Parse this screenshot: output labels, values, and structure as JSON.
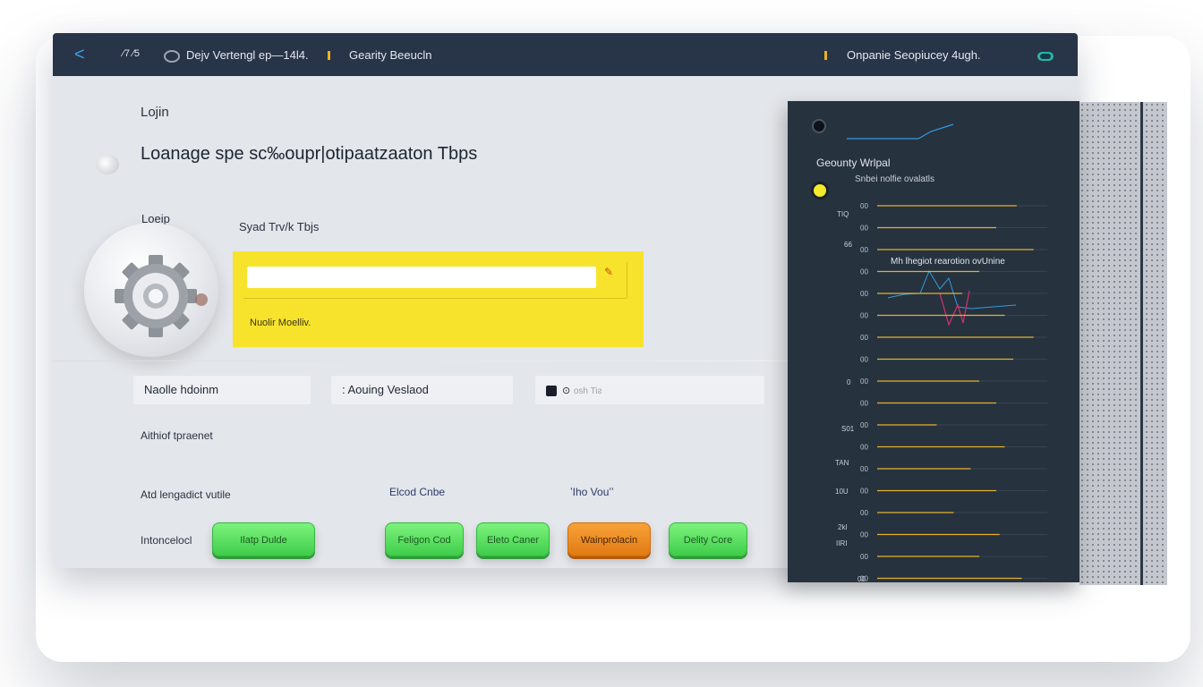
{
  "titlebar": {
    "back": "<",
    "item1": "⁄7 ⁄5",
    "item2": "Dejv Vertengl ep—14l4.",
    "item3": "Gearity Beeucln",
    "item4": "Onpanie Seopiucey 4ugh.",
    "accent_color": "#283448"
  },
  "main": {
    "label_top": "Lojin",
    "heading": "Loanage spe sc‰oupr|otipaatzaaton Tbps",
    "label_lojin": "Loeip",
    "label_syad": "Syad Trv/k Tbjs",
    "yellow_card": {
      "input_value": "",
      "note": "Nuolir Moelliv.",
      "edit": "✎",
      "color": "#f7e32c"
    },
    "fields": [
      {
        "value": "Naolle hdoinm"
      },
      {
        "value": ": Aouing Veslaod"
      },
      {
        "value": "",
        "placeholder": "osh   Tiƨ"
      }
    ],
    "field3_prefix": "⊙",
    "label_attrib": "Aithiof tpraenet",
    "label_atd": "Atd lengadict vutile",
    "label_elcod": "Elcod Cnbe",
    "label_ho": "ʼIho Vouʼʼ",
    "label_int": "Intoncelocl",
    "buttons": [
      {
        "label": "Ilatp Dulde",
        "color": "green"
      },
      {
        "label": "Feligon Cod",
        "color": "green"
      },
      {
        "label": "Eleto Caner",
        "color": "green"
      },
      {
        "label": "Wainprolacin",
        "color": "orange"
      },
      {
        "label": "Delity Core",
        "color": "green"
      }
    ]
  },
  "panel": {
    "title": "Geounty Wrlpal",
    "subtitle": "Snbei nolfie ovalatls",
    "annotation": "Mh lhegiot rearotion ovUnine",
    "side_labels": [
      "TIQ",
      "66",
      "0",
      "S01",
      "TAN",
      "10U",
      "2kl",
      "IIRI"
    ],
    "tick_label": "00",
    "bottom_label": "00",
    "line_color": "#e4b22a"
  },
  "chart_data": {
    "type": "line",
    "title": "Geounty Wrlpal",
    "subtitle": "Snbei nolfie ovalatls",
    "annotation": "Mh lhegiot rearotion ovUnine",
    "y_tick_labels": [
      "00",
      "00",
      "00",
      "00",
      "00",
      "00",
      "00",
      "00",
      "00",
      "00",
      "00",
      "00",
      "00",
      "00",
      "00",
      "00",
      "00",
      "00"
    ],
    "horizontal_bars": [
      0.82,
      0.7,
      0.92,
      0.6,
      0.5,
      0.75,
      0.92,
      0.8,
      0.6,
      0.7,
      0.35,
      0.75,
      0.55,
      0.7,
      0.45,
      0.72,
      0.6,
      0.85
    ],
    "grid": true
  }
}
